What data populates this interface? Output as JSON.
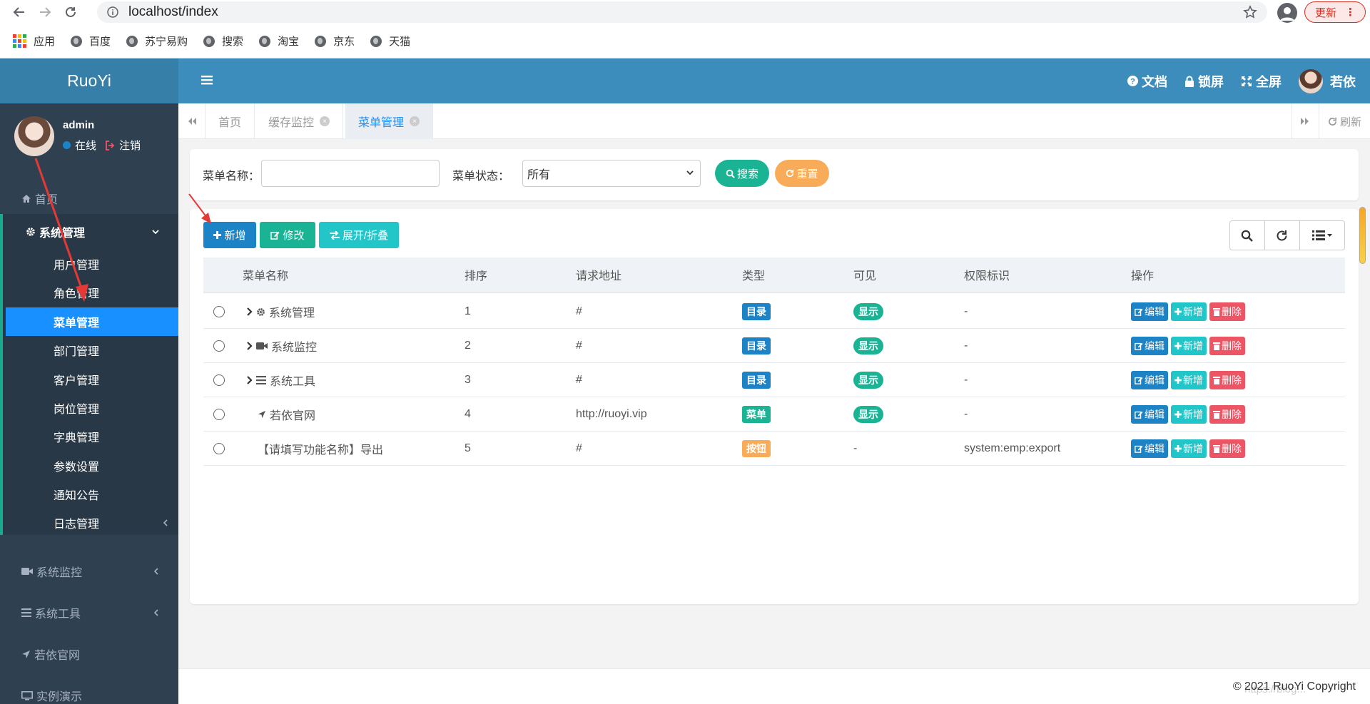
{
  "browser": {
    "url": "localhost/index",
    "update_label": "更新",
    "bookmarks": [
      "应用",
      "百度",
      "苏宁易购",
      "搜索",
      "淘宝",
      "京东",
      "天猫"
    ]
  },
  "app": {
    "logo": "RuoYi",
    "top_links": {
      "docs": "文档",
      "lock": "锁屏",
      "fullscreen": "全屏",
      "user": "若依"
    }
  },
  "sidebar": {
    "username": "admin",
    "online": "在线",
    "logout": "注销",
    "home": "首页",
    "system": "系统管理",
    "sub_items": [
      "用户管理",
      "角色管理",
      "菜单管理",
      "部门管理",
      "客户管理",
      "岗位管理",
      "字典管理",
      "参数设置",
      "通知公告",
      "日志管理"
    ],
    "monitor": "系统监控",
    "tools": "系统工具",
    "official": "若依官网",
    "demo": "实例演示"
  },
  "tabs": {
    "items": [
      "首页",
      "缓存监控",
      "菜单管理"
    ],
    "refresh": "刷新"
  },
  "search": {
    "name_label": "菜单名称：",
    "status_label": "菜单状态：",
    "status_value": "所有",
    "search_btn": "搜索",
    "reset_btn": "重置"
  },
  "toolbar": {
    "add": "新增",
    "edit": "修改",
    "expand": "展开/折叠"
  },
  "table": {
    "headers": [
      "菜单名称",
      "排序",
      "请求地址",
      "类型",
      "可见",
      "权限标识",
      "操作"
    ],
    "rows": [
      {
        "name": "系统管理",
        "order": "1",
        "url": "#",
        "type": "目录",
        "visible": "显示",
        "perm": "-"
      },
      {
        "name": "系统监控",
        "order": "2",
        "url": "#",
        "type": "目录",
        "visible": "显示",
        "perm": "-"
      },
      {
        "name": "系统工具",
        "order": "3",
        "url": "#",
        "type": "目录",
        "visible": "显示",
        "perm": "-"
      },
      {
        "name": "若依官网",
        "order": "4",
        "url": "http://ruoyi.vip",
        "type": "菜单",
        "visible": "显示",
        "perm": "-"
      },
      {
        "name": "【请填写功能名称】导出",
        "order": "5",
        "url": "#",
        "type": "按钮",
        "visible": "-",
        "perm": "system:emp:export"
      }
    ],
    "actions": {
      "edit": "编辑",
      "add": "新增",
      "delete": "删除"
    }
  },
  "footer": {
    "copyright": "© 2021 RuoYi Copyright",
    "watermark": "https://blog..."
  },
  "colors": {
    "primary": "#3c8dbc",
    "sidebar": "#2f4050",
    "active_menu": "#1890ff",
    "type_dir": "#1c84c6",
    "type_menu": "#1ab394",
    "type_button": "#f8ac59",
    "danger": "#ed5565"
  }
}
